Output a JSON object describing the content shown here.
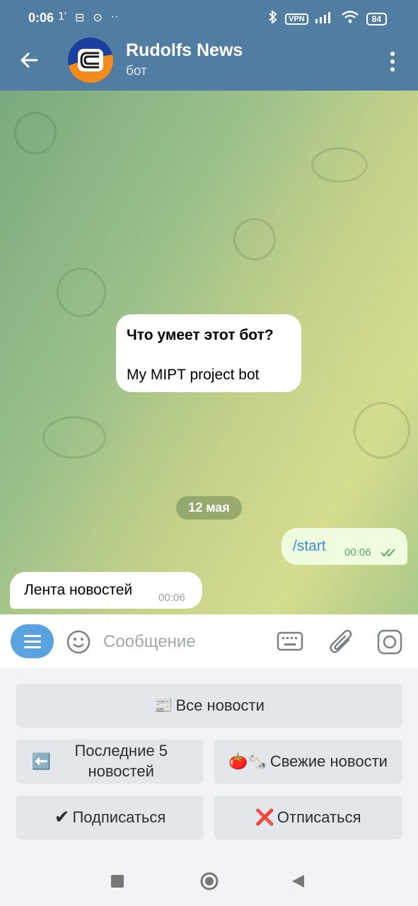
{
  "status_bar": {
    "time": "0:06",
    "left_glyphs": [
      "1ʹ",
      "⊟",
      "⊙",
      "··"
    ],
    "vpn_label": "VPN",
    "battery_level": "84"
  },
  "header": {
    "title": "Rudolfs News",
    "subtitle": "бот",
    "accent_color": "#527da3"
  },
  "chat": {
    "bot_info": {
      "title": "Что умеет этот бот?",
      "description": "My MIPT project bot"
    },
    "date_separator": "12 мая",
    "messages": [
      {
        "direction": "outgoing",
        "text": "/start",
        "time": "00:06",
        "read": true
      },
      {
        "direction": "incoming",
        "text": "Лента новостей",
        "time": "00:06"
      }
    ]
  },
  "input_bar": {
    "placeholder": "Сообщение",
    "menu_button_color": "#5aa3e0",
    "icons": [
      "menu-icon",
      "emoji-icon",
      "keyboard-icon",
      "attach-icon",
      "camera-icon"
    ]
  },
  "keyboard": {
    "buttons": [
      {
        "icon": "📰",
        "label": "Все новости"
      },
      {
        "icon": "⬅️",
        "label": "Последние 5 новостей"
      },
      {
        "icon": "🍅🗞️",
        "label": "Свежие новости"
      },
      {
        "icon": "✔",
        "label": "Подписаться"
      },
      {
        "icon": "❌",
        "label": "Отписаться"
      }
    ]
  }
}
